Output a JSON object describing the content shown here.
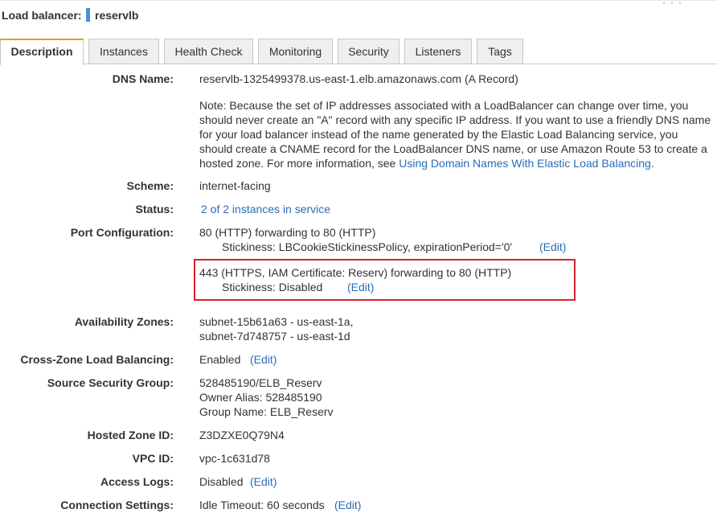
{
  "header": {
    "label": "Load balancer:",
    "name": "reservlb",
    "handle": "° ° °"
  },
  "tabs": [
    {
      "label": "Description",
      "active": true
    },
    {
      "label": "Instances"
    },
    {
      "label": "Health Check"
    },
    {
      "label": "Monitoring"
    },
    {
      "label": "Security"
    },
    {
      "label": "Listeners"
    },
    {
      "label": "Tags"
    }
  ],
  "details": {
    "dns_name": {
      "label": "DNS Name:",
      "value": "reservlb-1325499378.us-east-1.elb.amazonaws.com (A Record)",
      "note": "Note: Because the set of IP addresses associated with a LoadBalancer can change over time, you should never create an \"A\" record with any specific IP address. If you want to use a friendly DNS name for your load balancer instead of the name generated by the Elastic Load Balancing service, you should create a CNAME record for the LoadBalancer DNS name, or use Amazon Route 53 to create a hosted zone. For more information, see",
      "note_link": "Using Domain Names With Elastic Load Balancing",
      "note_end": "."
    },
    "scheme": {
      "label": "Scheme:",
      "value": "internet-facing"
    },
    "status": {
      "label": "Status:",
      "value": "2 of 2 instances in service"
    },
    "port_config": {
      "label": "Port Configuration:",
      "entries": [
        {
          "line1": "80 (HTTP) forwarding to 80 (HTTP)",
          "line2": "Stickiness: LBCookieStickinessPolicy, expirationPeriod='0'",
          "edit": "(Edit)"
        },
        {
          "line1": "443 (HTTPS, IAM Certificate: Reserv) forwarding to 80 (HTTP)",
          "line2": "Stickiness: Disabled",
          "edit": "(Edit)"
        }
      ]
    },
    "availability_zones": {
      "label": "Availability Zones:",
      "values": [
        "subnet-15b61a63 - us-east-1a,",
        "subnet-7d748757 - us-east-1d"
      ]
    },
    "cross_zone": {
      "label": "Cross-Zone Load Balancing:",
      "value": "Enabled",
      "edit": "(Edit)"
    },
    "source_security_group": {
      "label": "Source Security Group:",
      "values": [
        "528485190/ELB_Reserv",
        "Owner Alias: 528485190",
        "Group Name: ELB_Reserv"
      ]
    },
    "hosted_zone_id": {
      "label": "Hosted Zone ID:",
      "value": "Z3DZXE0Q79N4"
    },
    "vpc_id": {
      "label": "VPC ID:",
      "value": "vpc-1c631d78"
    },
    "access_logs": {
      "label": "Access Logs:",
      "value": "Disabled",
      "edit": "(Edit)"
    },
    "connection_settings": {
      "label": "Connection Settings:",
      "value": "Idle Timeout: 60 seconds",
      "edit": "(Edit)"
    }
  },
  "colors": {
    "link": "#2a6db5",
    "active_tab_accent": "#f09a1a",
    "highlight_box": "#d8222a",
    "name_marker": "#4a8fd8"
  }
}
